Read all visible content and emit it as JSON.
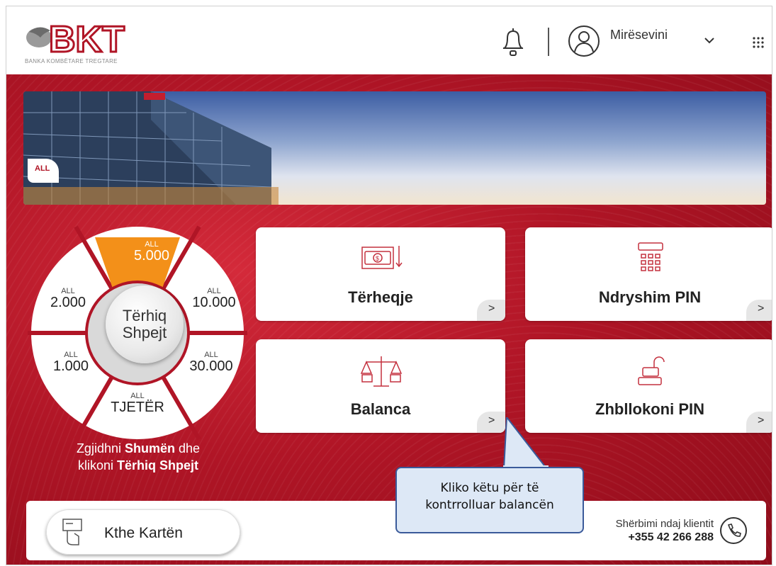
{
  "header": {
    "logo_text": "BKT",
    "logo_subtitle": "BANKA KOMBËTARE TREGTARE",
    "welcome": "Mirësevini"
  },
  "wheel": {
    "tag": "ALL",
    "amounts": [
      {
        "currency": "ALL",
        "amount": "5.000"
      },
      {
        "currency": "ALL",
        "amount": "10.000"
      },
      {
        "currency": "ALL",
        "amount": "30.000"
      },
      {
        "currency": "ALL",
        "amount": "TJETËR"
      },
      {
        "currency": "ALL",
        "amount": "1.000"
      },
      {
        "currency": "ALL",
        "amount": "2.000"
      }
    ],
    "center_line1": "Tërhiq",
    "center_line2": "Shpejt",
    "hint_pre": "Zgjidhni ",
    "hint_b1": "Shumën",
    "hint_mid": " dhe",
    "hint_pre2": "klikoni ",
    "hint_b2": "Tërhiq Shpejt"
  },
  "tiles": [
    {
      "label": "Tërheqje",
      "icon": "cash-withdraw-icon"
    },
    {
      "label": "Ndryshim PIN",
      "icon": "pin-keypad-icon"
    },
    {
      "label": "Balanca",
      "icon": "balance-scale-icon"
    },
    {
      "label": "Zhbllokoni PIN",
      "icon": "unlock-pin-icon"
    }
  ],
  "arrow": ">",
  "bottom": {
    "return_card": "Kthe Kartën",
    "service_label": "Shërbimi ndaj klientit",
    "service_phone": "+355 42 266 288"
  },
  "callout": {
    "line1": "Kliko këtu për të",
    "line2": "kontrrolluar balancën"
  },
  "colors": {
    "brand_red": "#b01526",
    "highlight_orange": "#f39019",
    "callout_blue": "#3a5a9a"
  }
}
